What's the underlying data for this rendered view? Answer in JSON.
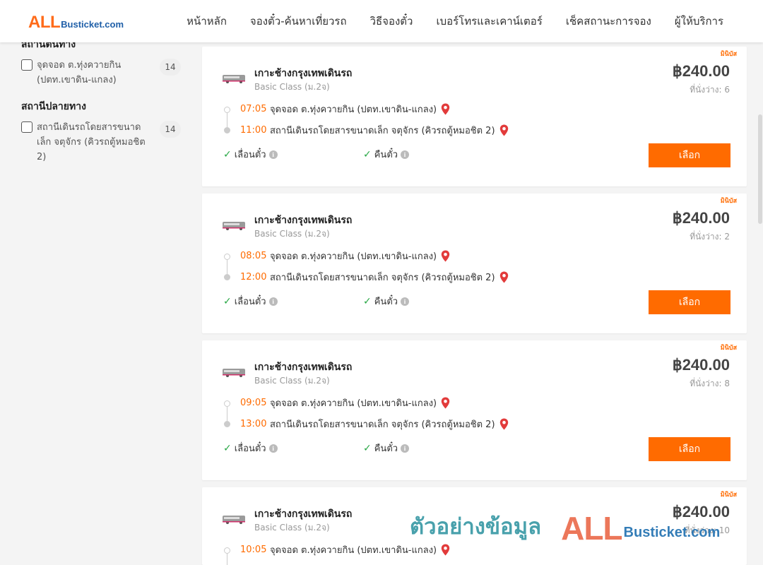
{
  "header": {
    "logo_all": "ALL",
    "logo_sub": "Busticket.com",
    "nav": [
      "หน้าหลัก",
      "จองตั๋ว-ค้นหาเที่ยวรถ",
      "วิธีจองตั๋ว",
      "เบอร์โทรและเคาน์เตอร์",
      "เช็คสถานะการจอง",
      "ผู้ให้บริการ"
    ]
  },
  "sidebar": {
    "origin_title": "สถานีต้นทาง",
    "origin_item": {
      "label": "จุดจอด ต.ทุ่งควายกิน (ปตท.เขาดิน-แกลง)",
      "count": "14"
    },
    "destination_title": "สถานีปลายทาง",
    "destination_item": {
      "label": "สถานีเดินรถโดยสารขนาดเล็ก จตุจักร (คิวรถตู้หมอชิต 2)",
      "count": "14"
    }
  },
  "trips": [
    {
      "badge": "มินิบัส",
      "operator": "เกาะช้างกรุงเทพเดินรถ",
      "class": "Basic Class (ม.2จ)",
      "price": "฿240.00",
      "seats": "ที่นั่งว่าง: 6",
      "dep_time": "07:05",
      "origin": "จุดจอด ต.ทุ่งควายกิน (ปตท.เขาดิน-แกลง)",
      "arr_time": "11:00",
      "destination": "สถานีเดินรถโดยสารขนาดเล็ก จตุจักร (คิวรถตู้หมอชิต 2)",
      "feature1": "เลื่อนตั๋ว",
      "feature2": "คืนตั๋ว",
      "button": "เลือก"
    },
    {
      "badge": "มินิบัส",
      "operator": "เกาะช้างกรุงเทพเดินรถ",
      "class": "Basic Class (ม.2จ)",
      "price": "฿240.00",
      "seats": "ที่นั่งว่าง: 2",
      "dep_time": "08:05",
      "origin": "จุดจอด ต.ทุ่งควายกิน (ปตท.เขาดิน-แกลง)",
      "arr_time": "12:00",
      "destination": "สถานีเดินรถโดยสารขนาดเล็ก จตุจักร (คิวรถตู้หมอชิต 2)",
      "feature1": "เลื่อนตั๋ว",
      "feature2": "คืนตั๋ว",
      "button": "เลือก"
    },
    {
      "badge": "มินิบัส",
      "operator": "เกาะช้างกรุงเทพเดินรถ",
      "class": "Basic Class (ม.2จ)",
      "price": "฿240.00",
      "seats": "ที่นั่งว่าง: 8",
      "dep_time": "09:05",
      "origin": "จุดจอด ต.ทุ่งควายกิน (ปตท.เขาดิน-แกลง)",
      "arr_time": "13:00",
      "destination": "สถานีเดินรถโดยสารขนาดเล็ก จตุจักร (คิวรถตู้หมอชิต 2)",
      "feature1": "เลื่อนตั๋ว",
      "feature2": "คืนตั๋ว",
      "button": "เลือก"
    },
    {
      "badge": "มินิบัส",
      "operator": "เกาะช้างกรุงเทพเดินรถ",
      "class": "Basic Class (ม.2จ)",
      "price": "฿240.00",
      "seats": "ที่นั่งว่าง: 10",
      "dep_time": "10:05",
      "origin": "จุดจอด ต.ทุ่งควายกิน (ปตท.เขาดิน-แกลง)",
      "arr_time": "",
      "destination": "",
      "feature1": "",
      "feature2": "",
      "button": ""
    }
  ],
  "watermark": {
    "text": "ตัวอย่างข้อมูล",
    "all": "ALL",
    "sub": "Busticket.com"
  },
  "colors": {
    "accent": "#ff6b00",
    "brand_blue": "#1f5fa8",
    "check_green": "#28a745"
  }
}
